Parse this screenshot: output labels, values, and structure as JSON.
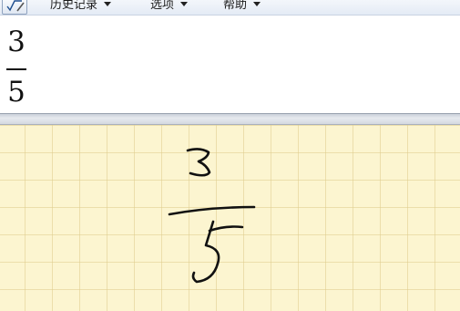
{
  "menu": {
    "history": "历史记录",
    "options": "选项",
    "help": "帮助"
  },
  "result": {
    "numerator": "3",
    "denominator": "5"
  },
  "icons": {
    "app": "math-input-icon",
    "dropdown": "dropdown-arrow-icon"
  },
  "colors": {
    "pad_background": "#fcf5d0",
    "ink": "#111111"
  }
}
